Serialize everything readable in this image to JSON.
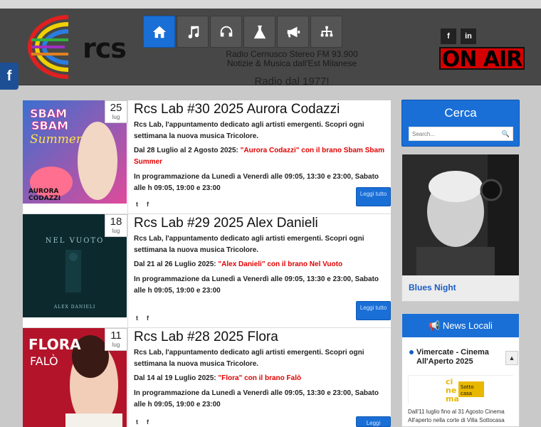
{
  "header": {
    "logo_text": "rcs",
    "station_line1": "Radio Cernusco Stereo FM 93.900",
    "station_line2": "Notizie & Musica dall'Est Milanese",
    "slogan": "Radio dal 1977!",
    "onair": "ON AIR",
    "social": [
      "f",
      "in"
    ],
    "side_fb": "f",
    "nav": [
      {
        "icon": "home-icon",
        "active": true
      },
      {
        "icon": "music-note-icon"
      },
      {
        "icon": "headphones-icon"
      },
      {
        "icon": "flask-icon"
      },
      {
        "icon": "megaphone-icon"
      },
      {
        "icon": "sitemap-icon"
      }
    ]
  },
  "posts": [
    {
      "day": "25",
      "month": "lug",
      "title": "Rcs Lab #30 2025 Aurora Codazzi",
      "intro": "Rcs Lab, l'appuntamento dedicato agli artisti emergenti. Scopri ogni settimana la nuova musica Tricolore.",
      "date_prefix": "Dal 28 Luglio al 2 Agosto 2025: ",
      "artist": "\"Aurora Codazzi\" con il brano Sbam Sbam Summer",
      "prog": "In programmazione da Lunedì a Venerdì alle 09:05, 13:30 e 23:00, Sabato alle h 09:05, 19:00 e 23:00",
      "thumb_text1": "SBAM",
      "thumb_text2": "SBAM",
      "thumb_text3": "Summer",
      "thumb_text4": "AURORA",
      "thumb_text5": "CODAZZI",
      "readmore": "Leggi tutto"
    },
    {
      "day": "18",
      "month": "lug",
      "title": "Rcs Lab #29 2025 Alex Danieli",
      "intro": "Rcs Lab, l'appuntamento dedicato agli artisti emergenti. Scopri ogni settimana la nuova musica Tricolore.",
      "date_prefix": "Dal 21 al 26 Luglio 2025: ",
      "artist": "\"Alex Danieli\" con il brano Nel Vuoto",
      "prog": "In programmazione da Lunedì a Venerdì alle 09:05, 13:30 e 23:00, Sabato alle h 09:05, 19:00 e 23:00",
      "thumb_text1": "NEL VUOTO",
      "thumb_text2": "ALEX DANIELI",
      "readmore": "Leggi tutto"
    },
    {
      "day": "11",
      "month": "lug",
      "title": "Rcs Lab #28 2025 Flora",
      "intro": "Rcs Lab, l'appuntamento dedicato agli artisti emergenti. Scopri ogni settimana la nuova musica Tricolore.",
      "date_prefix": "Dal 14 al 19 Luglio 2025: ",
      "artist": "\"Flora\" con il brano Falò",
      "prog": "In programmazione da Lunedì a Venerdì alle 09:05, 13:30 e 23:00, Sabato alle h 09:05, 19:00 e 23:00",
      "thumb_text1": "FLORA",
      "thumb_text2": "FALÒ",
      "readmore": "Leggi"
    }
  ],
  "share": {
    "twitter": "t",
    "facebook": "f"
  },
  "sidebar": {
    "search_title": "Cerca",
    "search_placeholder": "Search...",
    "show_caption": "Blues Night",
    "news_title": "News Locali",
    "news_item_title": "Vimercate - Cinema All'Aperto 2025",
    "news_img_text1": "ci",
    "news_img_text2": "ne",
    "news_img_text3": "ma",
    "news_img_text4": "Sotto",
    "news_img_text5": "casa",
    "news_item_text": "Dall'11 luglio fino al 31 Agosto Cinema All'aperto nella corte di Villa Sottocasa"
  },
  "colors": {
    "accent": "#1a6fd6",
    "header_bg": "#474747",
    "onair": "#d40000",
    "highlight": "#e00000"
  }
}
